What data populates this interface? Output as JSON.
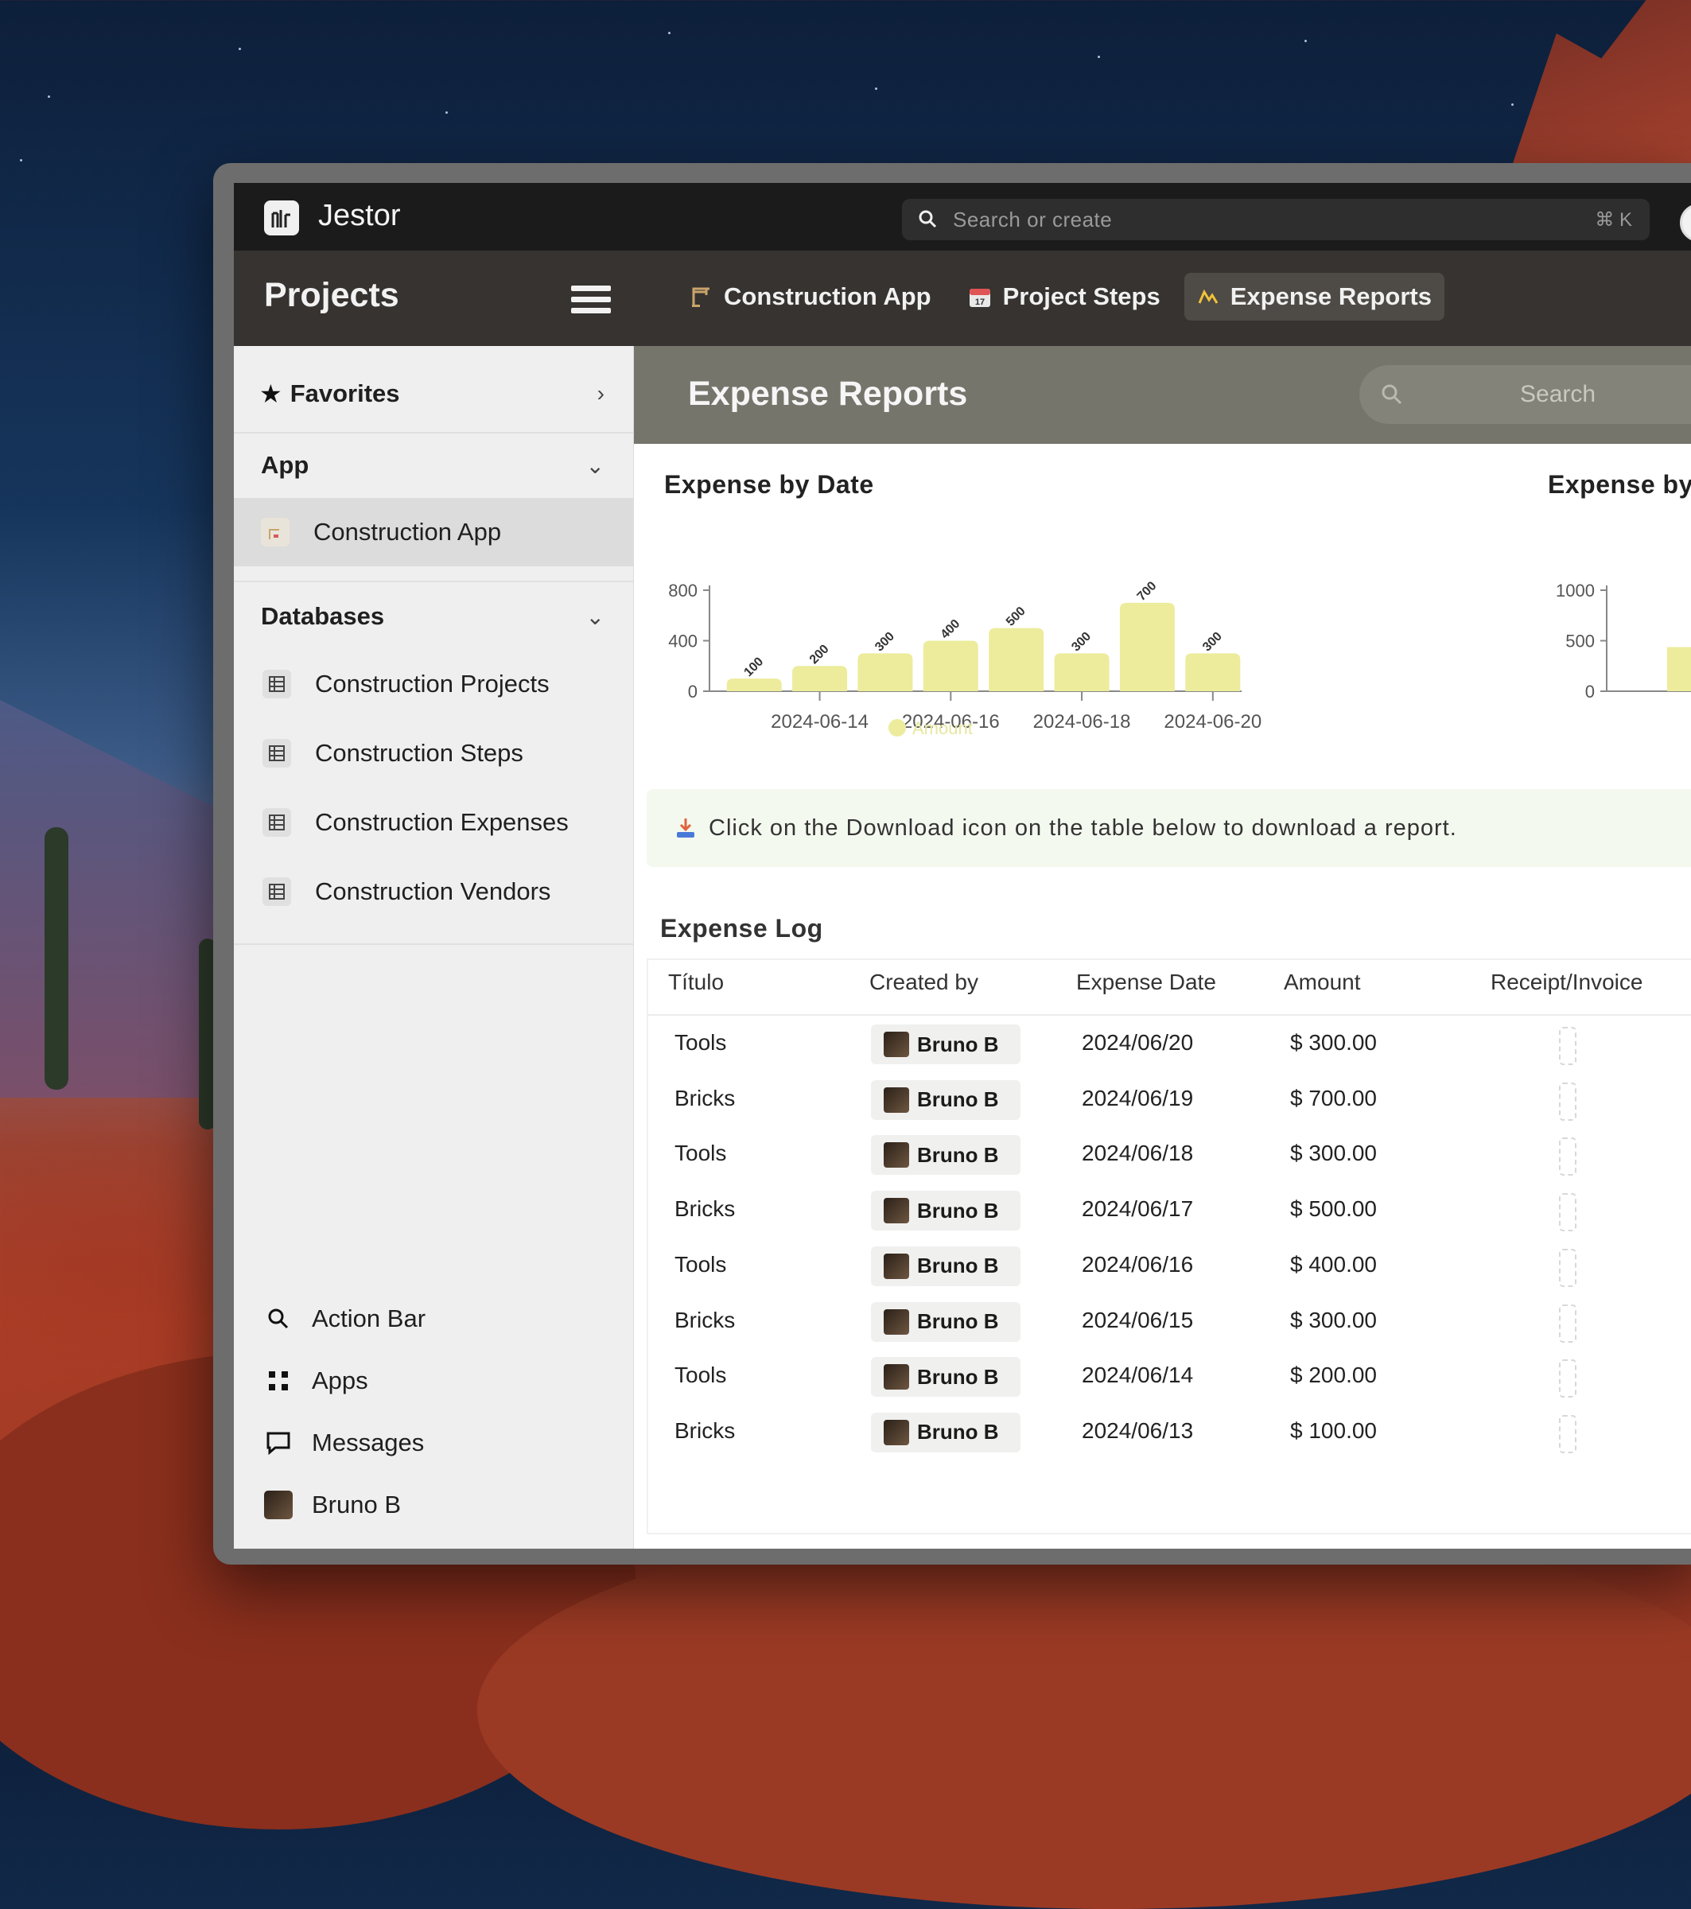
{
  "topbar": {
    "app_name": "Jestor",
    "search_placeholder": "Search or create",
    "shortcut": "⌘ K"
  },
  "navbar": {
    "title": "Projects",
    "tabs": [
      {
        "label": "Construction App",
        "icon": "crane-icon"
      },
      {
        "label": "Project Steps",
        "icon": "calendar-icon"
      },
      {
        "label": "Expense Reports",
        "icon": "chart-icon",
        "active": true
      }
    ]
  },
  "sidebar": {
    "favorites": "Favorites",
    "app_section": "App",
    "app_item": "Construction App",
    "databases_section": "Databases",
    "databases": [
      "Construction Projects",
      "Construction Steps",
      "Construction Expenses",
      "Construction Vendors"
    ],
    "footer": [
      {
        "label": "Action Bar",
        "icon": "search-icon"
      },
      {
        "label": "Apps",
        "icon": "grid-icon"
      },
      {
        "label": "Messages",
        "icon": "message-icon"
      },
      {
        "label": "Bruno B",
        "icon": "avatar"
      }
    ]
  },
  "main": {
    "title": "Expense Reports",
    "search_placeholder": "Search",
    "banner": "Click on the Download icon on the table below to download a report.",
    "log_title": "Expense Log",
    "columns": [
      "Título",
      "Created by",
      "Expense Date",
      "Amount",
      "Receipt/Invoice"
    ],
    "rows": [
      {
        "titulo": "Tools",
        "created_by": "Bruno B",
        "date": "2024/06/20",
        "amount": "$ 300.00"
      },
      {
        "titulo": "Bricks",
        "created_by": "Bruno B",
        "date": "2024/06/19",
        "amount": "$ 700.00"
      },
      {
        "titulo": "Tools",
        "created_by": "Bruno B",
        "date": "2024/06/18",
        "amount": "$ 300.00"
      },
      {
        "titulo": "Bricks",
        "created_by": "Bruno B",
        "date": "2024/06/17",
        "amount": "$ 500.00"
      },
      {
        "titulo": "Tools",
        "created_by": "Bruno B",
        "date": "2024/06/16",
        "amount": "$ 400.00"
      },
      {
        "titulo": "Bricks",
        "created_by": "Bruno B",
        "date": "2024/06/15",
        "amount": "$ 300.00"
      },
      {
        "titulo": "Tools",
        "created_by": "Bruno B",
        "date": "2024/06/14",
        "amount": "$ 200.00"
      },
      {
        "titulo": "Bricks",
        "created_by": "Bruno B",
        "date": "2024/06/13",
        "amount": "$ 100.00"
      }
    ]
  },
  "chart_data": [
    {
      "type": "bar",
      "title": "Expense by Date",
      "categories": [
        "2024-06-13",
        "2024-06-14",
        "2024-06-15",
        "2024-06-16",
        "2024-06-17",
        "2024-06-18",
        "2024-06-19",
        "2024-06-20"
      ],
      "tick_labels": [
        "2024-06-14",
        "2024-06-16",
        "2024-06-18",
        "2024-06-20"
      ],
      "series": [
        {
          "name": "Amount",
          "values": [
            100,
            200,
            300,
            400,
            500,
            300,
            700,
            300
          ]
        }
      ],
      "ylim": [
        0,
        800
      ],
      "yticks": [
        0,
        400,
        800
      ],
      "bar_color": "#ecec9c",
      "legend": "bottom"
    },
    {
      "type": "bar",
      "title": "Expense by",
      "yticks": [
        0,
        500,
        1000
      ],
      "ylim": [
        0,
        1000
      ]
    }
  ],
  "colors": {
    "topbar": "#1b1b1b",
    "navbar": "#363330",
    "header": "#75756c",
    "bar": "#ecec9c",
    "banner": "#f4f9ef"
  }
}
